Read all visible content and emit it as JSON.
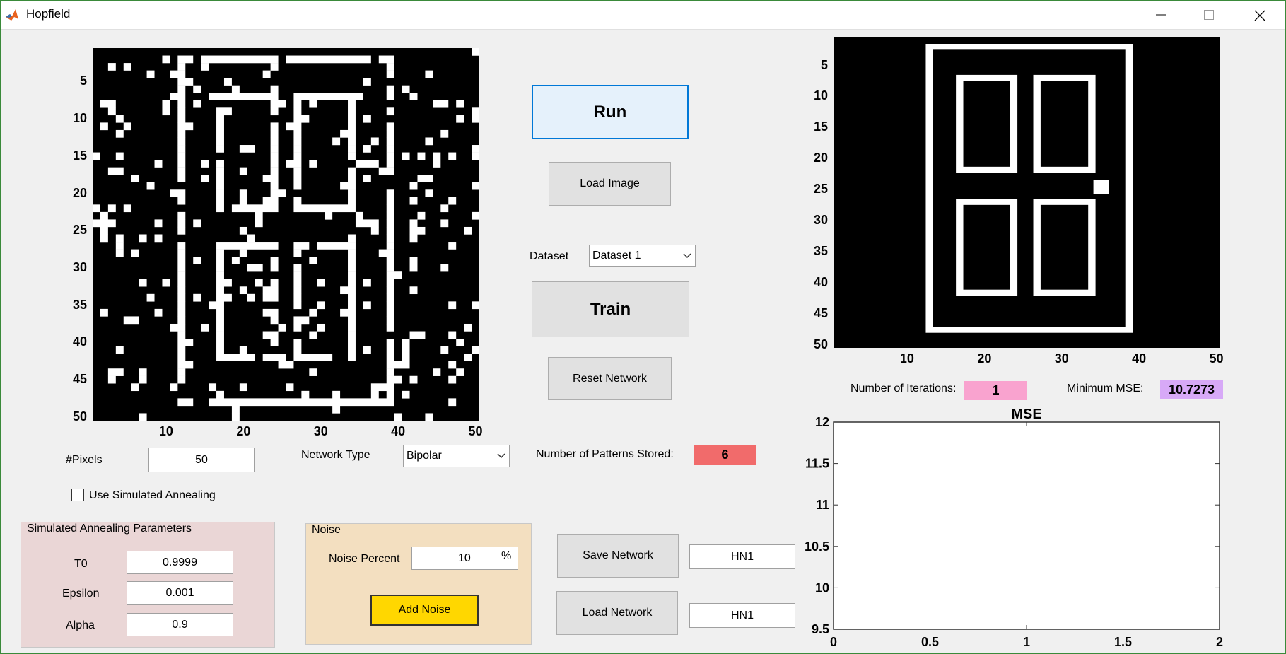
{
  "window": {
    "title": "Hopfield",
    "app_icon": "matlab-logo-icon"
  },
  "noisy_image": {
    "y_ticks": [
      "5",
      "10",
      "15",
      "20",
      "25",
      "30",
      "35",
      "40",
      "45",
      "50"
    ],
    "x_ticks": [
      "10",
      "20",
      "30",
      "40",
      "50"
    ]
  },
  "output_image": {
    "y_ticks": [
      "5",
      "10",
      "15",
      "20",
      "25",
      "30",
      "35",
      "40",
      "45",
      "50"
    ],
    "x_ticks": [
      "10",
      "20",
      "30",
      "40",
      "50"
    ]
  },
  "controls": {
    "run_label": "Run",
    "load_image_label": "Load Image",
    "dataset_label": "Dataset",
    "dataset_value": "Dataset 1",
    "train_label": "Train",
    "reset_label": "Reset Network",
    "patterns_label": "Number of Patterns Stored:",
    "patterns_value": "6",
    "save_network_label": "Save Network",
    "save_network_name": "HN1",
    "load_network_label": "Load Network",
    "load_network_name": "HN1"
  },
  "pixels": {
    "label": "#Pixels",
    "value": "50"
  },
  "network_type": {
    "label": "Network Type",
    "value": "Bipolar"
  },
  "annealing": {
    "checkbox_label": "Use Simulated Annealing",
    "checked": false,
    "panel_title": "Simulated Annealing Parameters",
    "params": [
      {
        "label": "T0",
        "value": "0.9999"
      },
      {
        "label": "Epsilon",
        "value": "0.001"
      },
      {
        "label": "Alpha",
        "value": "0.9"
      }
    ]
  },
  "noise": {
    "panel_title": "Noise",
    "percent_label": "Noise Percent",
    "percent_value": "10",
    "percent_unit": "%",
    "add_label": "Add Noise"
  },
  "stats": {
    "iterations_label": "Number of Iterations:",
    "iterations_value": "1",
    "mse_label": "Minimum MSE:",
    "mse_value": "10.7273"
  },
  "colors": {
    "patterns_badge": "#f16b6b",
    "iterations_badge": "#f9a3cf",
    "mse_badge": "#d7a9f7",
    "add_noise_button": "#ffd700",
    "annealing_panel": "#ead6d6",
    "noise_panel": "#f3dfc0"
  },
  "chart_data": {
    "type": "line",
    "title": "MSE",
    "xlabel": "",
    "ylabel": "",
    "xlim": [
      0,
      2
    ],
    "ylim": [
      9.5,
      12
    ],
    "x_ticks": [
      "0",
      "0.5",
      "1",
      "1.5",
      "2"
    ],
    "y_ticks": [
      "9.5",
      "10",
      "10.5",
      "11",
      "11.5",
      "12"
    ],
    "series": [],
    "grid": false
  }
}
